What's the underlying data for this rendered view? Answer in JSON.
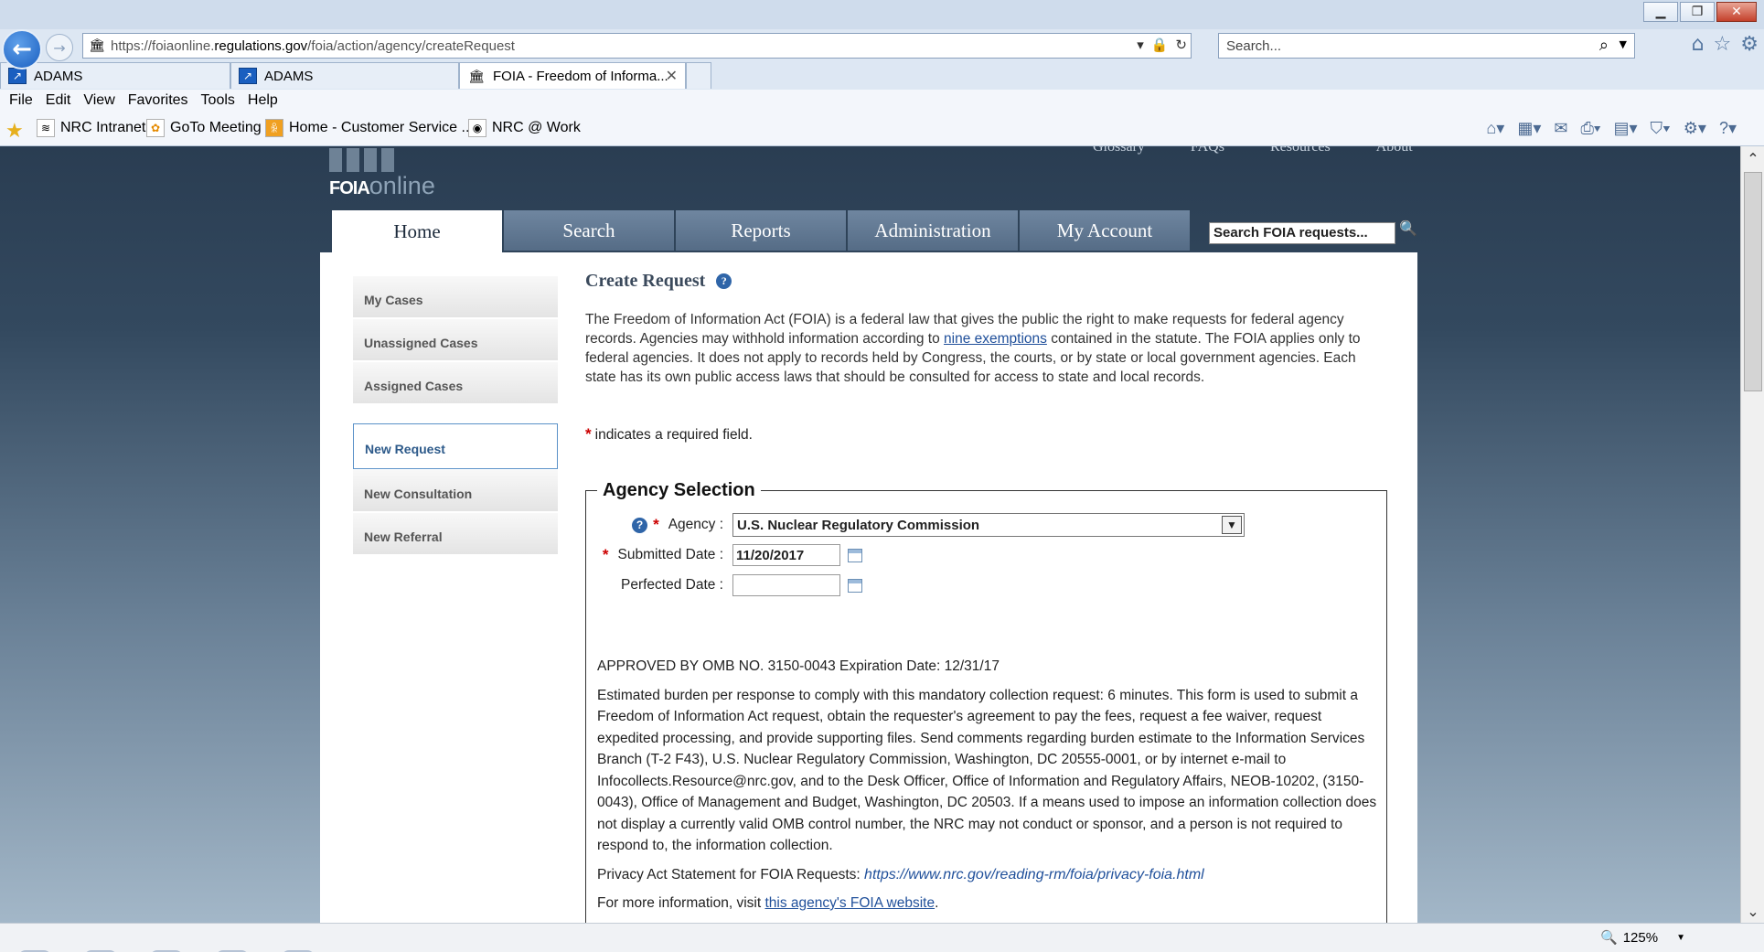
{
  "browser": {
    "url_prefix": "https://foiaonline.",
    "url_domain": "regulations.gov",
    "url_path": "/foia/action/agency/createRequest",
    "search_placeholder": "Search...",
    "tabs": [
      {
        "label": "ADAMS"
      },
      {
        "label": "ADAMS"
      },
      {
        "label": "FOIA - Freedom of Informa..."
      }
    ],
    "menu": [
      "File",
      "Edit",
      "View",
      "Favorites",
      "Tools",
      "Help"
    ],
    "favorites": [
      "NRC Intranet",
      "GoTo Meeting",
      "Home - Customer Service ...",
      "NRC @ Work"
    ],
    "zoom": "125%"
  },
  "site": {
    "top_links": [
      "Glossary",
      "FAQs",
      "Resources",
      "About"
    ],
    "logo_bold": "FOIA",
    "logo_light": "online",
    "main_tabs": [
      "Home",
      "Search",
      "Reports",
      "Administration",
      "My Account"
    ],
    "search_value": "Search FOIA requests..."
  },
  "sidenav": {
    "group1": [
      "My Cases",
      "Unassigned Cases",
      "Assigned Cases"
    ],
    "group2": [
      "New Request",
      "New Consultation",
      "New Referral"
    ]
  },
  "content": {
    "title": "Create Request",
    "intro_before_link": "The Freedom of Information Act (FOIA) is a federal law that gives the public the right to make requests for federal agency records. Agencies may withhold information according to ",
    "intro_link": "nine exemptions",
    "intro_after_link": " contained in the statute. The FOIA applies only to federal agencies. It does not apply to records held by Congress, the courts, or by state or local government agencies. Each state has its own public access laws that should be consulted for access to state and local records.",
    "required_note": "indicates a required field.",
    "fieldset_legend": "Agency Selection",
    "agency_label": "Agency :",
    "agency_value": "U.S. Nuclear Regulatory Commission",
    "submitted_label": "Submitted Date :",
    "submitted_value": "11/20/2017",
    "perfected_label": "Perfected Date :",
    "perfected_value": "",
    "omb_line": "APPROVED BY OMB NO. 3150-0043 Expiration Date: 12/31/17",
    "burden_text": "Estimated burden per response to comply with this mandatory collection request: 6 minutes. This form is used to submit a Freedom of Information Act request, obtain the requester's agreement to pay the fees, request a fee waiver, request expedited processing, and provide supporting files. Send comments regarding burden estimate to the Information Services Branch (T-2 F43), U.S. Nuclear Regulatory Commission, Washington, DC 20555-0001, or by internet e-mail to Infocollects.Resource@nrc.gov, and to the Desk Officer, Office of Information and Regulatory Affairs, NEOB-10202, (3150-0043), Office of Management and Budget, Washington, DC 20503. If a means used to impose an information collection does not display a currently valid OMB control number, the NRC may not conduct or sponsor, and a person is not required to respond to, the information collection.",
    "privacy_label": "Privacy Act Statement for FOIA Requests:",
    "privacy_url": "https://www.nrc.gov/reading-rm/foia/privacy-foia.html",
    "more_info_before": "For more information, visit ",
    "more_info_link": "this agency's FOIA website",
    "more_info_after": "."
  },
  "icons": {
    "back": "back-arrow-icon",
    "forward": "forward-arrow-icon",
    "help": "question-mark-icon",
    "calendar": "calendar-icon"
  }
}
